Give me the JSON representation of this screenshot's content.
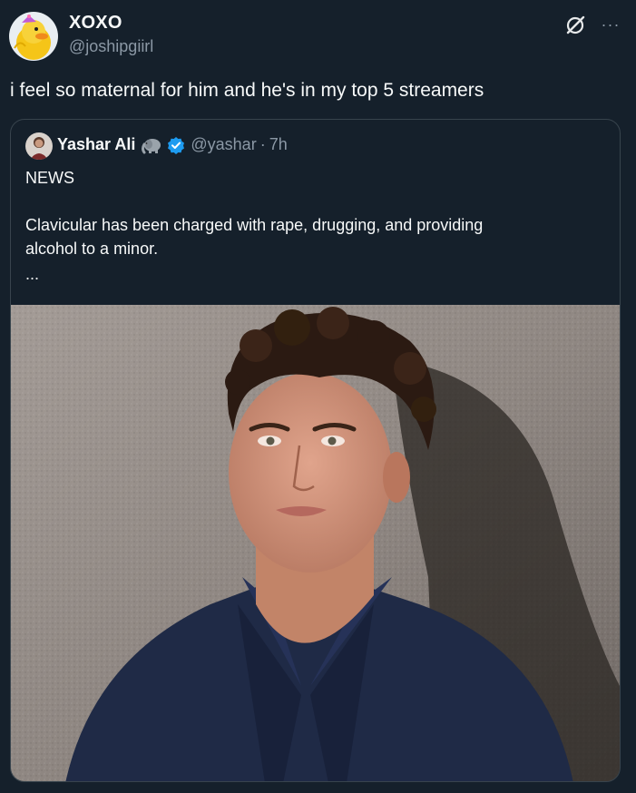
{
  "post": {
    "author": {
      "display_name": "XOXO",
      "handle": "@joshipgiirl",
      "avatar_icon": "duck-avatar-icon"
    },
    "actions": {
      "grok_icon": "grok-icon",
      "more_icon": "more-icon",
      "more_glyph": "···"
    },
    "text": "i feel so maternal for him and he's in my top 5 streamers",
    "quote": {
      "author": {
        "display_name": "Yashar Ali",
        "emoji_icon": "elephant-icon",
        "verified_icon": "verified-badge-icon",
        "handle": "@yashar",
        "separator": "·",
        "time": "7h"
      },
      "lines": [
        "NEWS",
        "Clavicular has been charged with rape, drugging, and providing",
        "alcohol to a minor.",
        "..."
      ],
      "image_icon": "portrait-photo"
    }
  },
  "colors": {
    "background": "#15202b",
    "text_primary": "#f7f9f9",
    "text_secondary": "#8b98a5",
    "border": "#38444d",
    "verified": "#1d9bf0"
  }
}
